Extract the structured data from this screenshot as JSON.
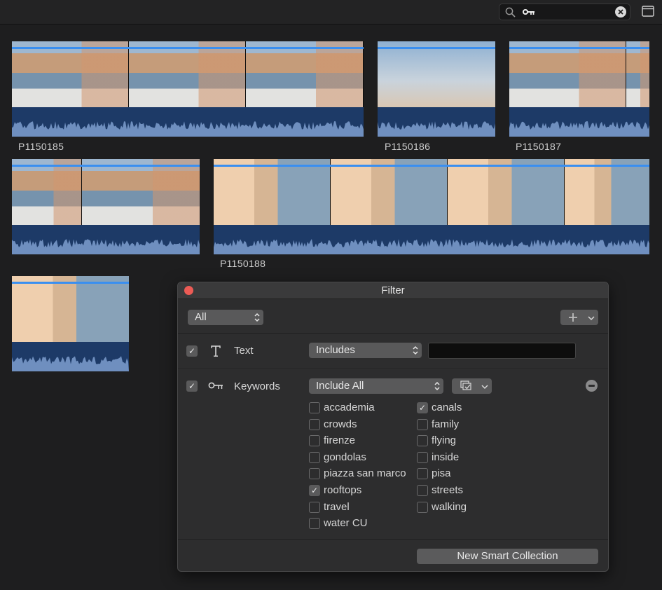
{
  "search": {
    "token_icon": "key-icon",
    "clear_icon": "clear-circle-icon"
  },
  "clips": [
    {
      "label": "P1150185"
    },
    {
      "label": "P1150186"
    },
    {
      "label": "P1150187"
    },
    {
      "label": "P1150188"
    }
  ],
  "filter": {
    "title": "Filter",
    "match_popup": "All",
    "add_icon": "plus-icon",
    "text_rule": {
      "label": "Text",
      "operator": "Includes",
      "value": "",
      "enabled": true
    },
    "keywords_rule": {
      "label": "Keywords",
      "operator": "Include All",
      "enabled": true,
      "keywords_col1": [
        {
          "name": "accademia",
          "checked": false
        },
        {
          "name": "crowds",
          "checked": false
        },
        {
          "name": "firenze",
          "checked": false
        },
        {
          "name": "gondolas",
          "checked": false
        },
        {
          "name": "piazza san marco",
          "checked": false
        },
        {
          "name": "rooftops",
          "checked": true
        },
        {
          "name": "travel",
          "checked": false
        },
        {
          "name": "water CU",
          "checked": false
        }
      ],
      "keywords_col2": [
        {
          "name": "canals",
          "checked": true
        },
        {
          "name": "family",
          "checked": false
        },
        {
          "name": "flying",
          "checked": false
        },
        {
          "name": "inside",
          "checked": false
        },
        {
          "name": "pisa",
          "checked": false
        },
        {
          "name": "streets",
          "checked": false
        },
        {
          "name": "walking",
          "checked": false
        }
      ]
    },
    "new_smart_collection": "New Smart Collection"
  },
  "colors": {
    "accent_blue_line": "#3a8ff0",
    "audio_waveform": "#1d3a67",
    "close_red": "#ec5b55"
  }
}
